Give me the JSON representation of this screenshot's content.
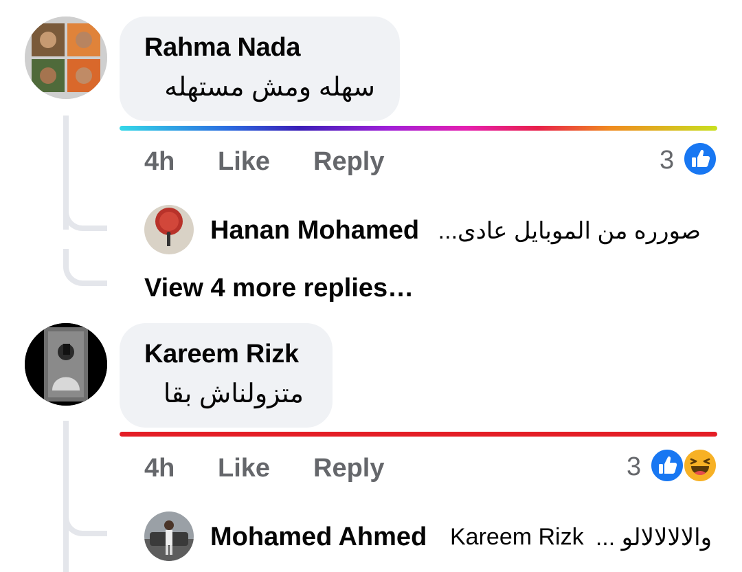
{
  "comments": [
    {
      "author": "Rahma Nada",
      "text": "سهله ومش مستهله",
      "time": "4h",
      "like_label": "Like",
      "reply_label": "Reply",
      "reaction_count": "3",
      "reactions": [
        "like-icon"
      ],
      "reply_preview": {
        "author": "Hanan Mohamed",
        "text": "صورره من الموبايل عادى..."
      },
      "view_more": "View 4 more replies…"
    },
    {
      "author": "Kareem Rizk",
      "text": "متزولناش بقا",
      "time": "4h",
      "like_label": "Like",
      "reply_label": "Reply",
      "reaction_count": "3",
      "reactions": [
        "like-icon",
        "haha-icon"
      ],
      "reply_preview": {
        "author": "Mohamed Ahmed",
        "mention": "Kareem Rizk",
        "text": "والالالالالو ..."
      }
    }
  ],
  "colors": {
    "like_blue": "#1877f2",
    "haha_yellow": "#f7b125",
    "bubble_bg": "#f0f2f5",
    "meta_gray": "#65676b",
    "red_bar": "#e41e26"
  }
}
